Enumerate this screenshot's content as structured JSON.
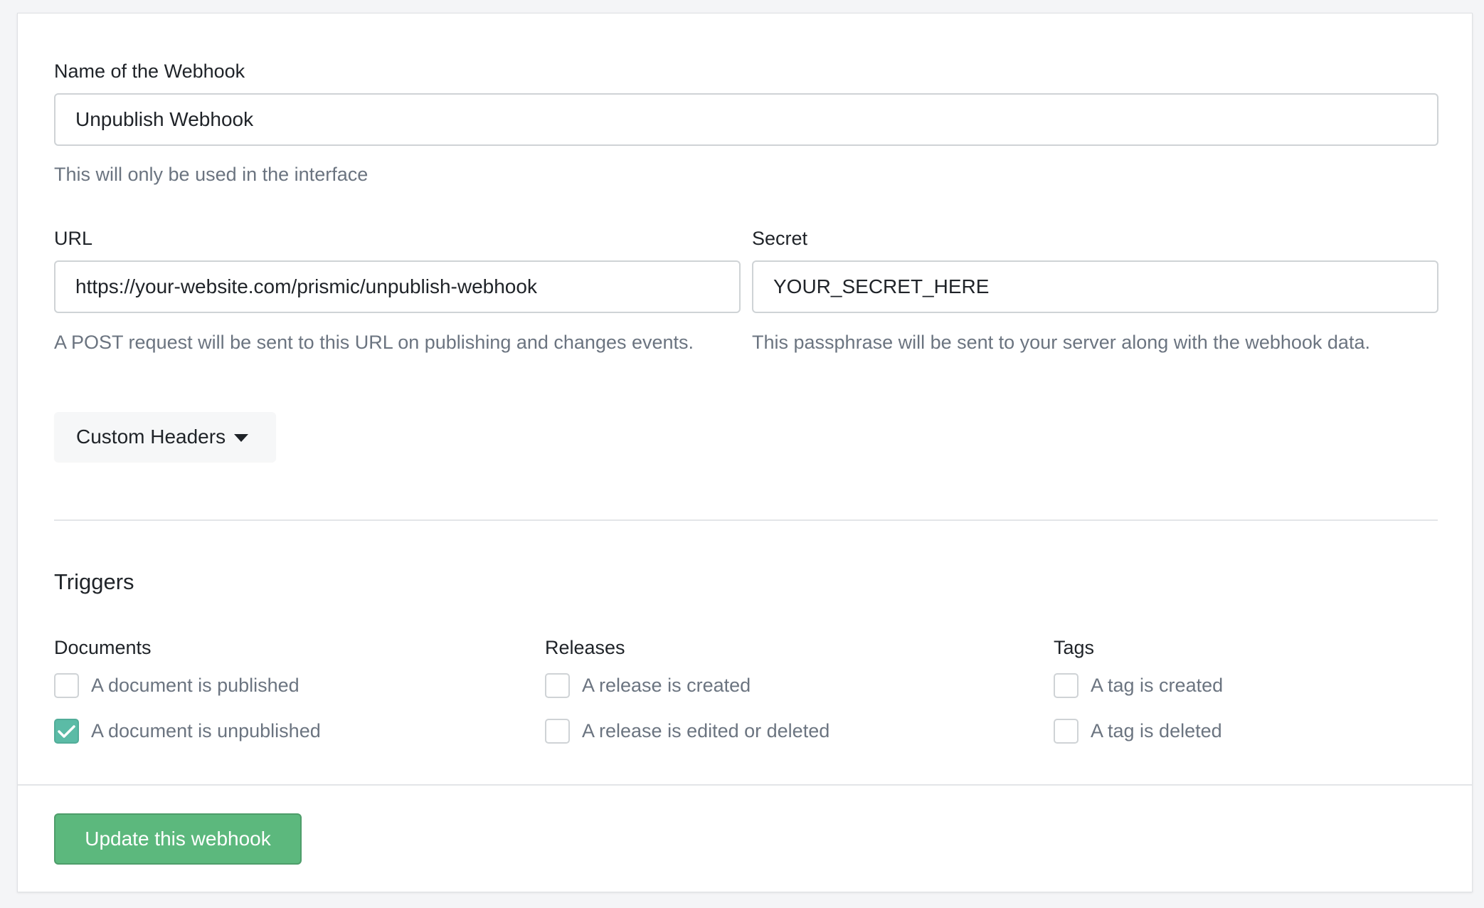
{
  "form": {
    "name_field": {
      "label": "Name of the Webhook",
      "value": "Unpublish Webhook",
      "help": "This will only be used in the interface"
    },
    "url_field": {
      "label": "URL",
      "value": "https://your-website.com/prismic/unpublish-webhook",
      "help": "A POST request will be sent to this URL on publishing and changes events."
    },
    "secret_field": {
      "label": "Secret",
      "value": "YOUR_SECRET_HERE",
      "help": "This passphrase will be sent to your server along with the webhook data."
    },
    "custom_headers": {
      "label": "Custom Headers",
      "icon": "caret-down-icon"
    }
  },
  "triggers": {
    "title": "Triggers",
    "groups": [
      {
        "title": "Documents",
        "options": [
          {
            "label": "A document is published",
            "checked": false
          },
          {
            "label": "A document is unpublished",
            "checked": true
          }
        ]
      },
      {
        "title": "Releases",
        "options": [
          {
            "label": "A release is created",
            "checked": false
          },
          {
            "label": "A release is edited or deleted",
            "checked": false
          }
        ]
      },
      {
        "title": "Tags",
        "options": [
          {
            "label": "A tag is created",
            "checked": false
          },
          {
            "label": "A tag is deleted",
            "checked": false
          }
        ]
      }
    ]
  },
  "footer": {
    "submit_label": "Update this webhook"
  },
  "colors": {
    "accent_green": "#5cb87d",
    "checkbox_checked": "#5bbba6",
    "help_text": "#6b7480",
    "page_background": "#f4f5f7"
  }
}
